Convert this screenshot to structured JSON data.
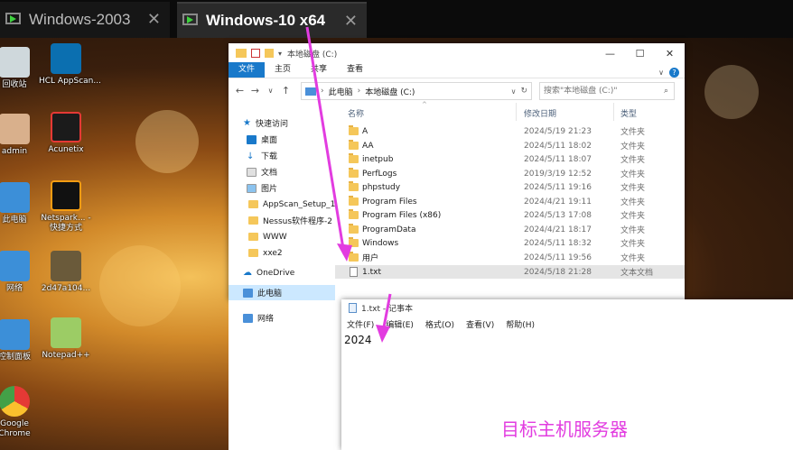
{
  "vm_tabs": [
    {
      "label": "Windows-2003",
      "close": "✕"
    },
    {
      "label": "Windows-10 x64",
      "close": "✕"
    }
  ],
  "desktop_icons": [
    {
      "label": "回收站",
      "color": "#cfd8dc"
    },
    {
      "label": "HCL AppScan...",
      "color": "#0b6fb0"
    },
    {
      "label": "admin",
      "color": "#d9b08c"
    },
    {
      "label": "Acunetix",
      "color": "#1b1b1b"
    },
    {
      "label": "此电脑",
      "color": "#3c8fd8"
    },
    {
      "label": "Netspark... - 快捷方式",
      "color": "#111111"
    },
    {
      "label": "网络",
      "color": "#3c8fd8"
    },
    {
      "label": "2d47a104...",
      "color": "#6a5a3a"
    },
    {
      "label": "控制面板",
      "color": "#3c8fd8"
    },
    {
      "label": "Notepad++",
      "color": "#9ccc65"
    },
    {
      "label": "Google Chrome",
      "color": "#e53935"
    }
  ],
  "explorer": {
    "title": "本地磁盘 (C:)",
    "window_buttons": [
      "—",
      "☐",
      "✕"
    ],
    "ribbon_tabs": [
      "文件",
      "主页",
      "共享",
      "查看"
    ],
    "nav_buttons": [
      "←",
      "→",
      "∨",
      "↑"
    ],
    "breadcrumb": [
      "此电脑",
      "本地磁盘 (C:)"
    ],
    "search_placeholder": "搜索\"本地磁盘 (C:)\"",
    "columns": {
      "name": "名称",
      "date": "修改日期",
      "type": "类型"
    },
    "nav_pane": [
      {
        "label": "快速访问",
        "kind": "star"
      },
      {
        "label": "桌面",
        "kind": "desktop"
      },
      {
        "label": "下载",
        "kind": "download"
      },
      {
        "label": "文档",
        "kind": "doc"
      },
      {
        "label": "图片",
        "kind": "pic"
      },
      {
        "label": "AppScan_Setup_1",
        "kind": "folder"
      },
      {
        "label": "Nessus软件程序-2",
        "kind": "folder"
      },
      {
        "label": "WWW",
        "kind": "folder"
      },
      {
        "label": "xxe2",
        "kind": "folder"
      },
      {
        "label": "OneDrive",
        "kind": "cloud"
      },
      {
        "label": "此电脑",
        "kind": "pc"
      },
      {
        "label": "网络",
        "kind": "net"
      }
    ],
    "files": [
      {
        "name": "A",
        "date": "2024/5/19 21:23",
        "type": "文件夹",
        "kind": "folder"
      },
      {
        "name": "AA",
        "date": "2024/5/11 18:02",
        "type": "文件夹",
        "kind": "folder"
      },
      {
        "name": "inetpub",
        "date": "2024/5/11 18:07",
        "type": "文件夹",
        "kind": "folder"
      },
      {
        "name": "PerfLogs",
        "date": "2019/3/19 12:52",
        "type": "文件夹",
        "kind": "folder"
      },
      {
        "name": "phpstudy",
        "date": "2024/5/11 19:16",
        "type": "文件夹",
        "kind": "folder"
      },
      {
        "name": "Program Files",
        "date": "2024/4/21 19:11",
        "type": "文件夹",
        "kind": "folder"
      },
      {
        "name": "Program Files (x86)",
        "date": "2024/5/13 17:08",
        "type": "文件夹",
        "kind": "folder"
      },
      {
        "name": "ProgramData",
        "date": "2024/4/21 18:17",
        "type": "文件夹",
        "kind": "folder"
      },
      {
        "name": "Windows",
        "date": "2024/5/11 18:32",
        "type": "文件夹",
        "kind": "folder"
      },
      {
        "name": "用户",
        "date": "2024/5/11 19:56",
        "type": "文件夹",
        "kind": "folder"
      },
      {
        "name": "1.txt",
        "date": "2024/5/18 21:28",
        "type": "文本文档",
        "kind": "txt"
      }
    ]
  },
  "notepad": {
    "title": "1.txt - 记事本",
    "menu": [
      "文件(F)",
      "编辑(E)",
      "格式(O)",
      "查看(V)",
      "帮助(H)"
    ],
    "content": "2024"
  },
  "caption": "目标主机服务器",
  "colors": {
    "accent": "#1979ca",
    "annotation": "#e23ce0",
    "selected": "#cce8ff"
  }
}
